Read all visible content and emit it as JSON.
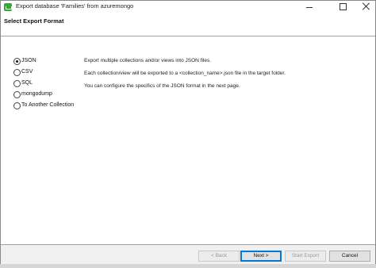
{
  "window": {
    "title": "Export database 'Families' from azuremongo"
  },
  "header": {
    "title": "Select Export Format"
  },
  "formats": [
    {
      "label": "JSON",
      "checked": true
    },
    {
      "label": "CSV",
      "checked": false
    },
    {
      "label": "SQL",
      "checked": false
    },
    {
      "label": "mongodump",
      "checked": false
    },
    {
      "label": "To Another Collection",
      "checked": false
    }
  ],
  "description": {
    "line1": "Export multiple collections and/or views into JSON files.",
    "line2": "Each collection/view will be exported to a <collection_name>.json file in the target folder.",
    "line3": "You can configure the specifics of the JSON format in the next page."
  },
  "footer": {
    "back_label": "< Back",
    "next_label": "Next >",
    "start_label": "Start Export",
    "cancel_label": "Cancel"
  }
}
